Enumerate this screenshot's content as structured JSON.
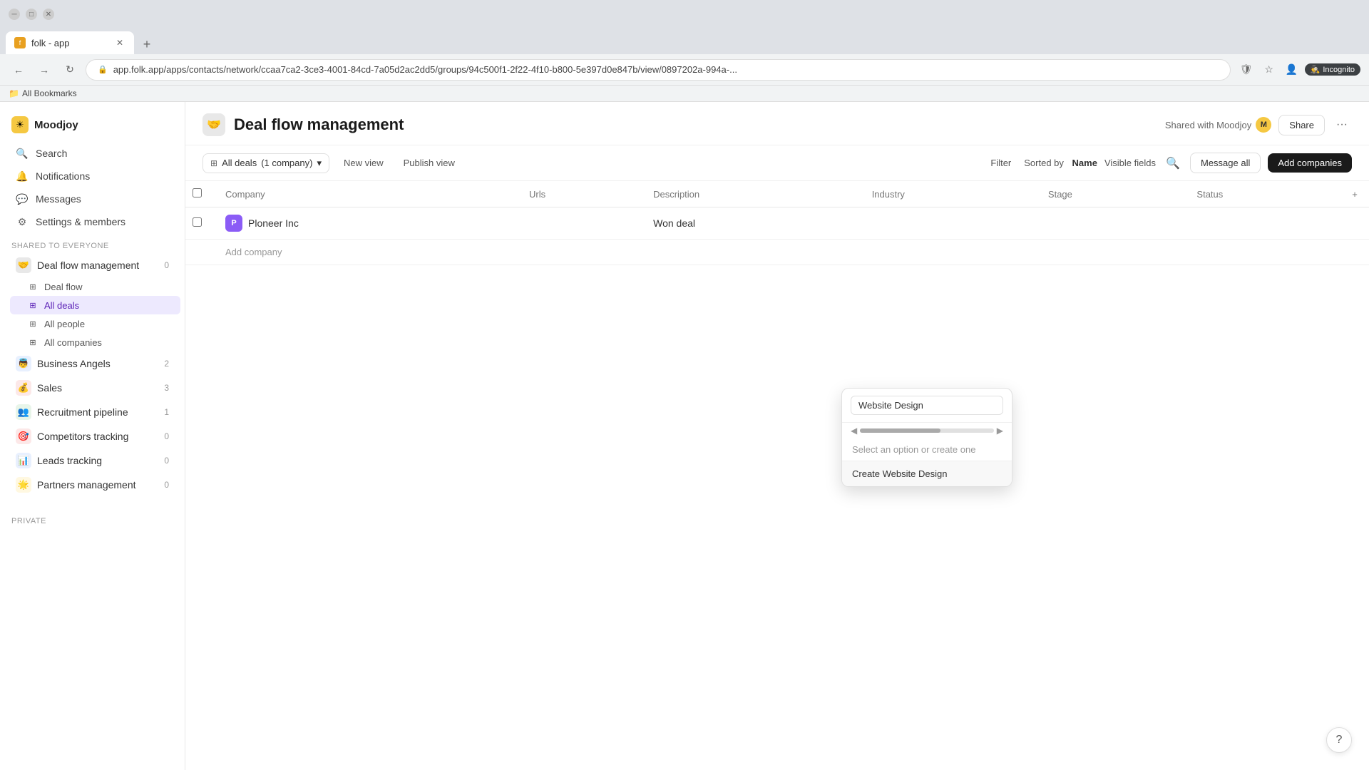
{
  "browser": {
    "tab_title": "folk - app",
    "tab_favicon": "f",
    "address": "app.folk.app/apps/contacts/network/ccaa7ca2-3ce3-4001-84cd-7a05d2ac2dd5/groups/94c500f1-2f22-4f10-b800-5e397d0e847b/view/0897202a-994a-...",
    "incognito_label": "Incognito",
    "bookmarks_label": "All Bookmarks"
  },
  "sidebar": {
    "brand": {
      "name": "Moodjoy",
      "icon": "☀"
    },
    "nav": [
      {
        "id": "search",
        "label": "Search",
        "icon": "🔍"
      },
      {
        "id": "notifications",
        "label": "Notifications",
        "icon": "🔔"
      },
      {
        "id": "messages",
        "label": "Messages",
        "icon": "💬"
      },
      {
        "id": "settings",
        "label": "Settings & members",
        "icon": "⚙"
      }
    ],
    "section_label": "Shared to everyone",
    "groups": [
      {
        "id": "deal-flow-management",
        "name": "Deal flow management",
        "icon": "🤝",
        "icon_bg": "#e8e8e8",
        "count": "0",
        "expanded": true,
        "children": [
          {
            "id": "deal-flow",
            "label": "Deal flow",
            "icon": "⊞"
          },
          {
            "id": "all-deals",
            "label": "All deals",
            "icon": "⊞",
            "active": true
          },
          {
            "id": "all-people",
            "label": "All people",
            "icon": "⊞"
          },
          {
            "id": "all-companies",
            "label": "All companies",
            "icon": "⊞"
          }
        ]
      },
      {
        "id": "business-angels",
        "name": "Business Angels",
        "icon": "👼",
        "icon_bg": "#e8f0fe",
        "count": "2",
        "expanded": false,
        "children": []
      },
      {
        "id": "sales",
        "name": "Sales",
        "icon": "💰",
        "icon_bg": "#fce8e8",
        "count": "3",
        "expanded": false,
        "children": []
      },
      {
        "id": "recruitment-pipeline",
        "name": "Recruitment pipeline",
        "icon": "👥",
        "icon_bg": "#e8f5e9",
        "count": "1",
        "expanded": false,
        "children": []
      },
      {
        "id": "competitors-tracking",
        "name": "Competitors tracking",
        "icon": "🎯",
        "icon_bg": "#fce8e8",
        "count": "0",
        "expanded": false,
        "children": []
      },
      {
        "id": "leads-tracking",
        "name": "Leads tracking",
        "icon": "📊",
        "icon_bg": "#e8f0fe",
        "count": "0",
        "expanded": false,
        "children": []
      },
      {
        "id": "partners-management",
        "name": "Partners management",
        "icon": "🌟",
        "icon_bg": "#fff8e1",
        "count": "0",
        "expanded": false,
        "children": []
      }
    ],
    "private_label": "Private"
  },
  "header": {
    "icon": "🤝",
    "title": "Deal flow management",
    "shared_label": "Shared with Moodjoy",
    "shared_icon": "M",
    "share_btn": "Share",
    "more_btn": "···"
  },
  "toolbar": {
    "view_icon": "⊞",
    "view_label": "All deals",
    "view_count": "1 company",
    "new_view": "New view",
    "publish_view": "Publish view",
    "filter": "Filter",
    "sorted_by_label": "Sorted by",
    "sorted_by_key": "Name",
    "visible_fields": "Visible fields",
    "message_all": "Message all",
    "add_companies": "Add companies"
  },
  "table": {
    "columns": [
      {
        "id": "company",
        "label": "Company"
      },
      {
        "id": "urls",
        "label": "Urls"
      },
      {
        "id": "description",
        "label": "Description"
      },
      {
        "id": "industry",
        "label": "Industry"
      },
      {
        "id": "stage",
        "label": "Stage"
      },
      {
        "id": "status",
        "label": "Status"
      }
    ],
    "rows": [
      {
        "company": "Ploneer Inc",
        "company_initial": "P",
        "urls": "",
        "description": "Won deal",
        "industry": "",
        "stage": "",
        "status": ""
      }
    ],
    "add_row_label": "Add company"
  },
  "industry_dropdown": {
    "input_value": "Website Design",
    "hint": "Select an option or create one",
    "create_label": "Create Website Design"
  },
  "help": {
    "icon": "?"
  }
}
